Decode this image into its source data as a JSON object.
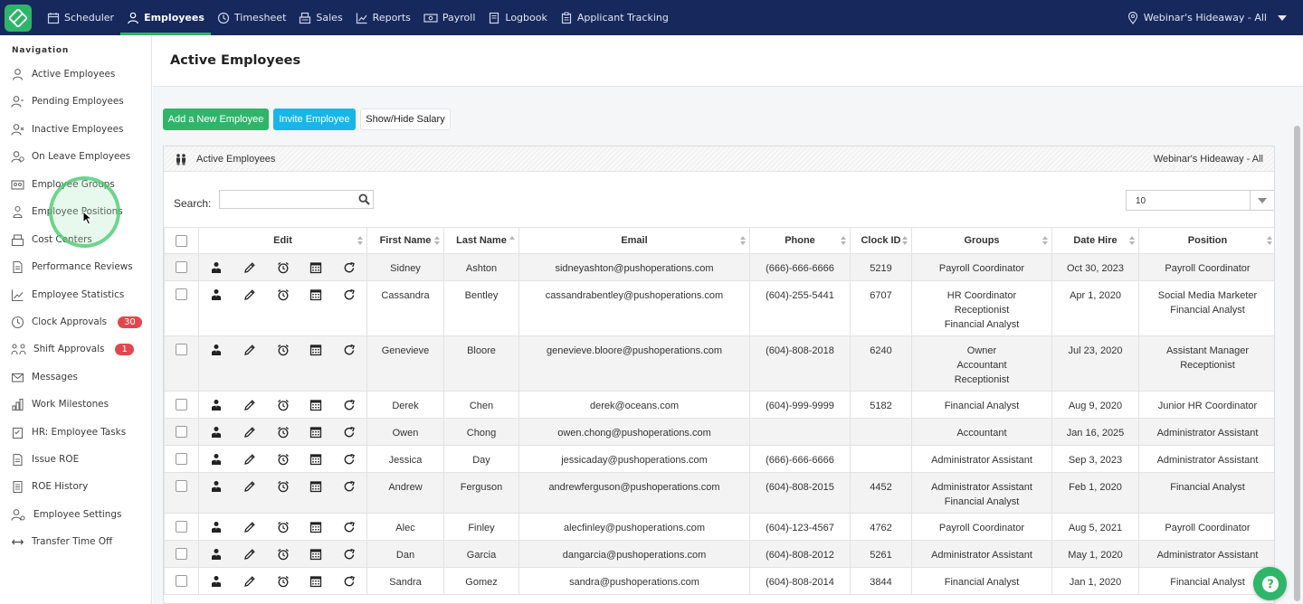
{
  "topnav": {
    "items": [
      {
        "label": "Scheduler",
        "icon": "calendar-icon"
      },
      {
        "label": "Employees",
        "icon": "person-icon",
        "active": true
      },
      {
        "label": "Timesheet",
        "icon": "clock-icon"
      },
      {
        "label": "Sales",
        "icon": "register-icon"
      },
      {
        "label": "Reports",
        "icon": "chart-icon"
      },
      {
        "label": "Payroll",
        "icon": "money-icon"
      },
      {
        "label": "Logbook",
        "icon": "book-icon"
      },
      {
        "label": "Applicant Tracking",
        "icon": "clipboard-icon"
      }
    ],
    "location": "Webinar's Hideaway - All"
  },
  "sidebar": {
    "title": "Navigation",
    "items": [
      {
        "label": "Active Employees"
      },
      {
        "label": "Pending Employees"
      },
      {
        "label": "Inactive Employees"
      },
      {
        "label": "On Leave Employees"
      },
      {
        "label": "Employee Groups"
      },
      {
        "label": "Employee Positions"
      },
      {
        "label": "Cost Centers"
      },
      {
        "label": "Performance Reviews"
      },
      {
        "label": "Employee Statistics"
      },
      {
        "label": "Clock Approvals",
        "badge": "30"
      },
      {
        "label": "Shift Approvals",
        "badge": "1"
      },
      {
        "label": "Messages"
      },
      {
        "label": "Work Milestones"
      },
      {
        "label": "HR: Employee Tasks"
      },
      {
        "label": "Issue ROE"
      },
      {
        "label": "ROE History"
      },
      {
        "label": "Employee Settings"
      },
      {
        "label": "Transfer Time Off"
      }
    ]
  },
  "page": {
    "title": "Active Employees",
    "add_button": "Add a New Employee",
    "invite_button": "Invite Employee",
    "salary_button": "Show/Hide Salary"
  },
  "panel": {
    "title": "Active Employees",
    "location": "Webinar's Hideaway - All",
    "search_label": "Search:",
    "search_value": "",
    "page_size": "10"
  },
  "table": {
    "columns": [
      "Edit",
      "First Name",
      "Last Name",
      "Email",
      "Phone",
      "Clock ID",
      "Groups",
      "Date Hire",
      "Position"
    ],
    "rows": [
      {
        "first": "Sidney",
        "last": "Ashton",
        "email": "sidneyashton@pushoperations.com",
        "phone": "(666)-666-6666",
        "clock": "5219",
        "groups": [
          "Payroll Coordinator"
        ],
        "hire": "Oct 30, 2023",
        "position": [
          "Payroll Coordinator"
        ]
      },
      {
        "first": "Cassandra",
        "last": "Bentley",
        "email": "cassandrabentley@pushoperations.com",
        "phone": "(604)-255-5441",
        "clock": "6707",
        "groups": [
          "HR Coordinator",
          "Receptionist",
          "Financial Analyst"
        ],
        "hire": "Apr 1, 2020",
        "position": [
          "Social Media Marketer",
          "Financial Analyst"
        ]
      },
      {
        "first": "Genevieve",
        "last": "Bloore",
        "email": "genevieve.bloore@pushoperations.com",
        "phone": "(604)-808-2018",
        "clock": "6240",
        "groups": [
          "Owner",
          "Accountant",
          "Receptionist"
        ],
        "hire": "Jul 23, 2020",
        "position": [
          "Assistant Manager",
          "Receptionist"
        ]
      },
      {
        "first": "Derek",
        "last": "Chen",
        "email": "derek@oceans.com",
        "phone": "(604)-999-9999",
        "clock": "5182",
        "groups": [
          "Financial Analyst"
        ],
        "hire": "Aug 9, 2020",
        "position": [
          "Junior HR Coordinator"
        ]
      },
      {
        "first": "Owen",
        "last": "Chong",
        "email": "owen.chong@pushoperations.com",
        "phone": "",
        "clock": "",
        "groups": [
          "Accountant"
        ],
        "hire": "Jan 16, 2025",
        "position": [
          "Administrator Assistant"
        ]
      },
      {
        "first": "Jessica",
        "last": "Day",
        "email": "jessicaday@pushoperations.com",
        "phone": "(666)-666-6666",
        "clock": "",
        "groups": [
          "Administrator Assistant"
        ],
        "hire": "Sep 3, 2023",
        "position": [
          "Administrator Assistant"
        ]
      },
      {
        "first": "Andrew",
        "last": "Ferguson",
        "email": "andrewferguson@pushoperations.com",
        "phone": "(604)-808-2015",
        "clock": "4452",
        "groups": [
          "Administrator Assistant",
          "Financial Analyst"
        ],
        "hire": "Feb 1, 2020",
        "position": [
          "Financial Analyst"
        ]
      },
      {
        "first": "Alec",
        "last": "Finley",
        "email": "alecfinley@pushoperations.com",
        "phone": "(604)-123-4567",
        "clock": "4762",
        "groups": [
          "Payroll Coordinator"
        ],
        "hire": "Aug 5, 2021",
        "position": [
          "Payroll Coordinator"
        ]
      },
      {
        "first": "Dan",
        "last": "Garcia",
        "email": "dangarcia@pushoperations.com",
        "phone": "(604)-808-2012",
        "clock": "5261",
        "groups": [
          "Administrator Assistant"
        ],
        "hire": "May 1, 2020",
        "position": [
          "Administrator Assistant"
        ]
      },
      {
        "first": "Sandra",
        "last": "Gomez",
        "email": "sandra@pushoperations.com",
        "phone": "(604)-808-2014",
        "clock": "3844",
        "groups": [
          "Financial Analyst"
        ],
        "hire": "Jan 1, 2020",
        "position": [
          "Financial Analyst"
        ]
      }
    ]
  },
  "colors": {
    "navbar": "#16285c",
    "accent_green": "#2fb56a",
    "accent_blue": "#16b7e8",
    "badge_red": "#e2474d"
  }
}
